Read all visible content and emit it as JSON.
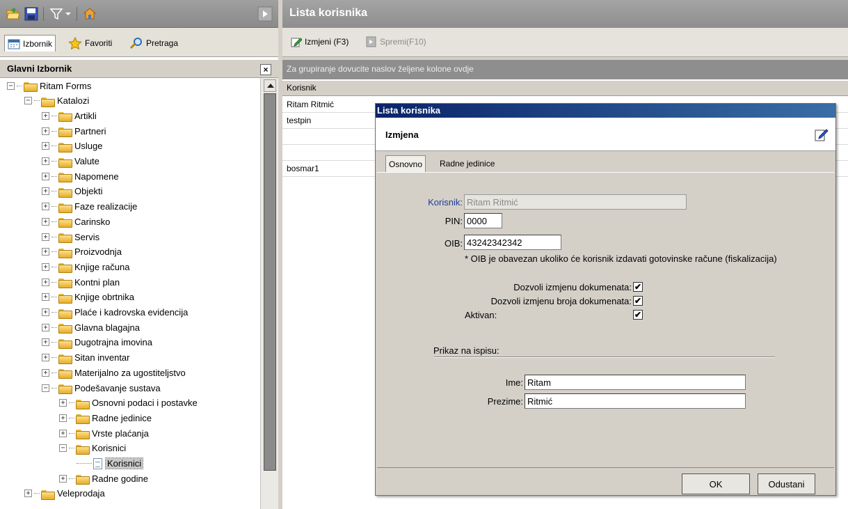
{
  "left": {
    "tabs": {
      "izbornik": "Izbornik",
      "favoriti": "Favoriti",
      "pretraga": "Pretraga"
    },
    "tree_title": "Glavni Izbornik",
    "tree_close": "×",
    "tree": {
      "root": "Ritam Forms",
      "katalozi": "Katalozi",
      "items": [
        "Artikli",
        "Partneri",
        "Usluge",
        "Valute",
        "Napomene",
        "Objekti",
        "Faze realizacije",
        "Carinsko",
        "Servis",
        "Proizvodnja",
        "Knjige računa",
        "Kontni plan",
        "Knjige obrtnika",
        "Plaće i kadrovska evidencija",
        "Glavna blagajna",
        "Dugotrajna imovina",
        "Sitan inventar",
        "Materijalno za ugostiteljstvo"
      ],
      "podesavanje": "Podešavanje sustava",
      "sub": [
        "Osnovni podaci i postavke",
        "Radne jedinice",
        "Vrste plaćanja"
      ],
      "korisnici_folder": "Korisnici",
      "korisnici_item": "Korisnici",
      "radne_godine": "Radne godine",
      "veleprodaja": "Veleprodaja"
    },
    "toolbar_icons": [
      "open-folder-icon",
      "save-icon",
      "filter-icon",
      "dropdown-icon",
      "home-icon",
      "play-icon"
    ]
  },
  "right": {
    "title": "Lista korisnika",
    "toolbar": {
      "izmjeni": "Izmjeni (F3)",
      "spremi": "Spremi(F10)"
    },
    "group_hint": "Za grupiranje dovucite naslov željene kolone ovdje",
    "grid": {
      "column": "Korisnik",
      "rows": [
        "Ritam Ritmić",
        "testpin",
        "",
        "",
        "bosmar1"
      ]
    }
  },
  "dialog": {
    "window_title": "Lista korisnika",
    "header": "Izmjena",
    "tabs": [
      "Osnovno",
      "Radne jedinice"
    ],
    "korisnik_label": "Korisnik:",
    "korisnik_value": "Ritam Ritmić",
    "pin_label": "PIN:",
    "pin_value": "0000",
    "oib_label": "OIB:",
    "oib_value": "43242342342",
    "oib_note": "* OIB je obavezan ukoliko će korisnik izdavati gotovinske račune (fiskalizacija)",
    "chk1_label": "Dozvoli izmjenu dokumenata:",
    "chk2_label": "Dozvoli izmjenu broja dokumenata:",
    "chk3_label": "Aktivan:",
    "checked": [
      true,
      true,
      true
    ],
    "prikaz_label": "Prikaz na ispisu:",
    "ime_label": "Ime:",
    "ime_value": "Ritam",
    "prezime_label": "Prezime:",
    "prezime_value": "Ritmić",
    "ok": "OK",
    "cancel": "Odustani"
  }
}
